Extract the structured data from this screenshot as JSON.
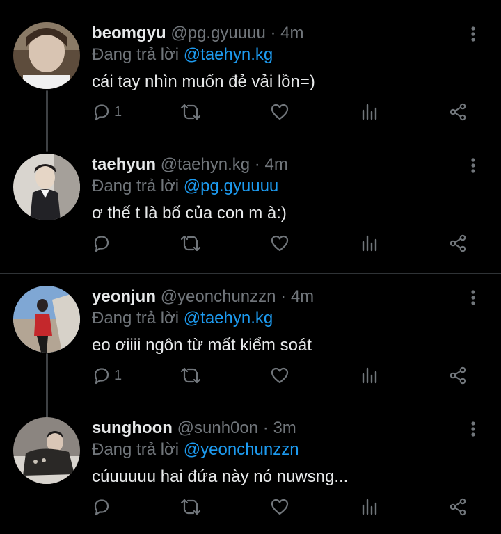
{
  "reply_prefix": "Đang trả lời",
  "tweets": [
    {
      "display_name": "beomgyu",
      "handle": "@pg.gyuuuu",
      "separator": "·",
      "time": "4m",
      "reply_to": "@taehyn.kg",
      "text": "cái tay nhìn muốn đẻ vải lồn=)",
      "reply_count": "1"
    },
    {
      "display_name": "taehyun",
      "handle": "@taehyn.kg",
      "separator": "·",
      "time": "4m",
      "reply_to": "@pg.gyuuuu",
      "text": "ơ thế t là bố của con m à:)",
      "reply_count": ""
    },
    {
      "display_name": "yeonjun",
      "handle": "@yeonchunzzn",
      "separator": "·",
      "time": "4m",
      "reply_to": "@taehyn.kg",
      "text": "eo ơiiii ngôn từ mất kiểm soát",
      "reply_count": "1"
    },
    {
      "display_name": "sunghoon",
      "handle": "@sunh0on",
      "separator": "·",
      "time": "3m",
      "reply_to": "@yeonchunzzn",
      "text": "cúuuuuu hai đứa này nó nuwsng...",
      "reply_count": ""
    }
  ],
  "colors": {
    "background": "#000000",
    "text": "#e7e9ea",
    "secondary": "#71767b",
    "mention": "#1d9bf0",
    "divider": "#2f3336"
  },
  "icons": [
    "reply-icon",
    "retweet-icon",
    "like-icon",
    "views-icon",
    "share-icon",
    "more-icon"
  ]
}
